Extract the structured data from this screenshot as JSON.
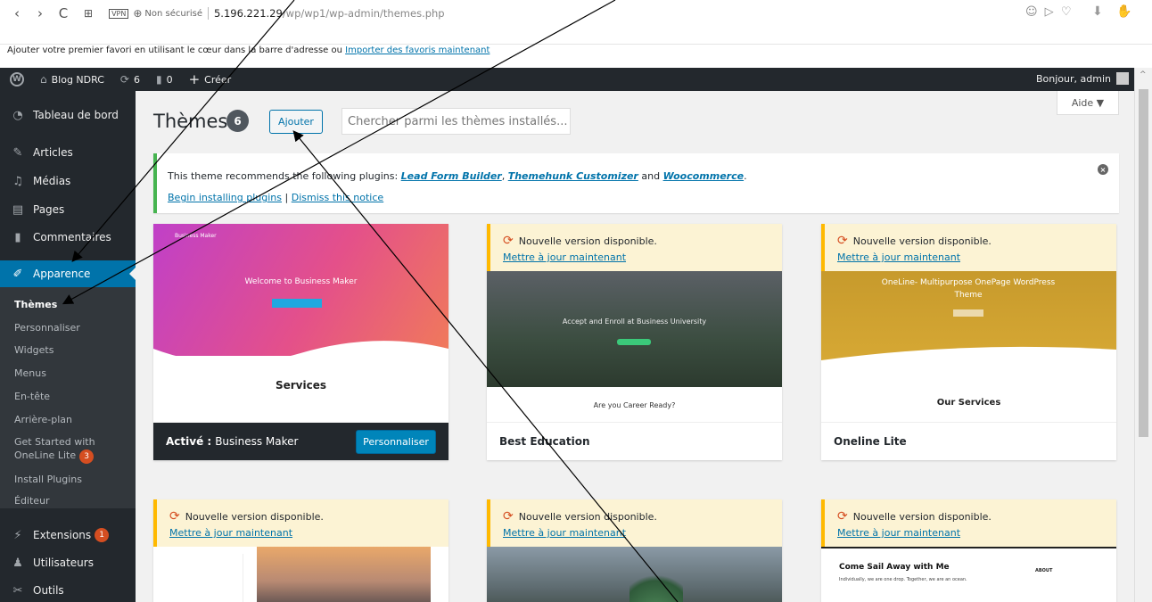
{
  "browser": {
    "back": "‹",
    "forward": "›",
    "reload": "C",
    "grid": "⊞",
    "vpn": "VPN",
    "insecure": "Non sécurisé",
    "url_host": "5.196.221.29",
    "url_path": "/wp/wp1/wp-admin/themes.php",
    "favorites_text": "Ajouter votre premier favori en utilisant le cœur dans la barre d'adresse ou ",
    "favorites_link": "Importer des favoris maintenant"
  },
  "admin_bar": {
    "site_name": "Blog NDRC",
    "updates_count": "6",
    "comments_count": "0",
    "create_label": "Créer",
    "greeting": "Bonjour, admin"
  },
  "sidebar": {
    "items": [
      {
        "label": "Tableau de bord",
        "icon": "dashboard-icon"
      },
      {
        "label": "Articles",
        "icon": "pin-icon"
      },
      {
        "label": "Médias",
        "icon": "media-icon"
      },
      {
        "label": "Pages",
        "icon": "pages-icon"
      },
      {
        "label": "Commentaires",
        "icon": "comment-icon"
      },
      {
        "label": "Apparence",
        "icon": "brush-icon"
      },
      {
        "label": "Extensions",
        "icon": "plugin-icon",
        "badge": "1"
      },
      {
        "label": "Utilisateurs",
        "icon": "users-icon"
      },
      {
        "label": "Outils",
        "icon": "tools-icon"
      }
    ],
    "submenu": [
      "Thèmes",
      "Personnaliser",
      "Widgets",
      "Menus",
      "En-tête",
      "Arrière-plan",
      "Get Started with",
      "OneLine Lite",
      "Install Plugins",
      "Éditeur"
    ],
    "getstarted_badge": "3"
  },
  "main": {
    "title": "Thèmes",
    "theme_count": "6",
    "add_label": "Ajouter",
    "search_placeholder": "Chercher parmi les thèmes installés...",
    "help_label": "Aide ▼",
    "notice": {
      "text_before": "This theme recommends the following plugins: ",
      "plugin1": "Lead Form Builder",
      "comma": ", ",
      "plugin2": "Themehunk Customizer",
      "and": " and ",
      "plugin3": "Woocommerce",
      "period": ".",
      "begin_link": "Begin installing plugins",
      "pipe": " | ",
      "dismiss_link": "Dismiss this notice"
    },
    "update_text": "Nouvelle version disponible.",
    "update_link": "Mettre à jour maintenant",
    "themes": [
      {
        "name": "Business Maker",
        "active_label": "Activé :",
        "customize_label": "Personnaliser",
        "preview_heading": "Welcome to Business Maker",
        "preview_logo": "Business Maker",
        "preview_section": "Services"
      },
      {
        "name": "Best Education",
        "preview_heading": "Accept and Enroll at Business University",
        "preview_section": "Are you Career Ready?"
      },
      {
        "name": "Oneline Lite",
        "preview_heading": "OneLine- Multipurpose OnePage WordPress Theme",
        "preview_section": "Our Services"
      },
      {
        "name": ""
      },
      {
        "name": ""
      },
      {
        "name": "",
        "preview_heading": "Come Sail Away with Me",
        "preview_sub": "Individually, we are one drop. Together, we are an ocean.",
        "preview_about": "ABOUT"
      }
    ]
  },
  "colors": {
    "admin_bar": "#23282d",
    "accent": "#0073aa",
    "notice_success": "#46b450",
    "update_warning": "#ffb900"
  }
}
